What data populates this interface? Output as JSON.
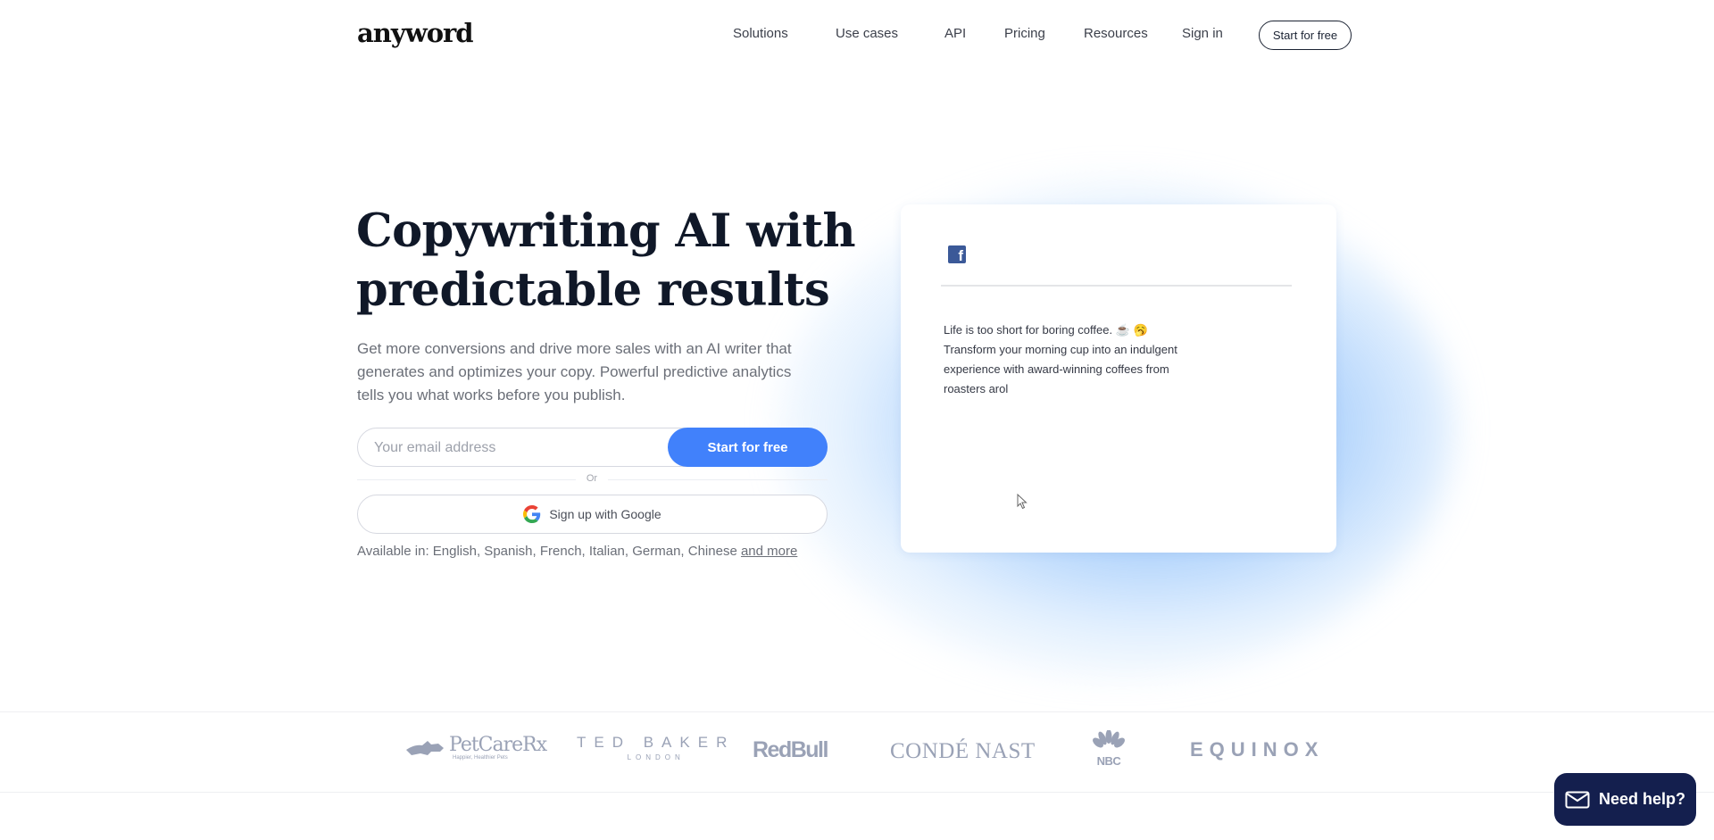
{
  "header": {
    "logo": "anyword",
    "nav": [
      {
        "label": "Solutions"
      },
      {
        "label": "Use cases"
      },
      {
        "label": "API"
      },
      {
        "label": "Pricing"
      },
      {
        "label": "Resources"
      },
      {
        "label": "Sign in"
      }
    ],
    "cta_label": "Start for free"
  },
  "hero": {
    "title_line1": "Copywriting AI with",
    "title_line2": "predictable results",
    "subtitle": "Get more conversions and drive more sales with an AI writer that generates and optimizes your copy. Powerful predictive analytics tells you what works before you publish.",
    "email_placeholder": "Your email address",
    "email_value": "",
    "cta_label": "Start for free",
    "or_label": "Or",
    "google_label": "Sign up with Google",
    "available_prefix": "Available in: English, Spanish, French, Italian, German, Chinese",
    "available_link": "and more"
  },
  "preview_card": {
    "platform_icon": "facebook-icon",
    "lines": [
      "Life is too short for boring coffee. ☕ 🥱",
      "Transform your morning cup into an indulgent",
      "experience with award-winning coffees from",
      "roasters arol"
    ]
  },
  "logos": [
    {
      "name": "PetCareRx",
      "tagline": "Happier, Healthier Pets"
    },
    {
      "name": "TED BAKER",
      "tagline": "LONDON"
    },
    {
      "name": "RedBull"
    },
    {
      "name": "CONDÉ NAST"
    },
    {
      "name": "NBC"
    },
    {
      "name": "EQUINOX"
    }
  ],
  "help_widget": {
    "label": "Need help?"
  },
  "colors": {
    "accent": "#4181fb",
    "help_bg": "#141f4e",
    "facebook": "#3b5998",
    "heading": "#101828"
  }
}
